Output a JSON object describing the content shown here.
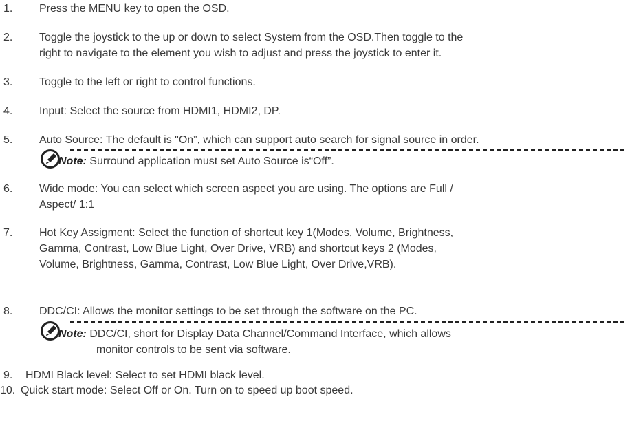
{
  "items": [
    {
      "num": "1.",
      "lines": [
        "Press the MENU key to open the OSD."
      ]
    },
    {
      "num": "2.",
      "lines": [
        "Toggle the joystick to the up or down to select System from the OSD.Then toggle to the",
        "right to navigate to the element you wish to adjust and press the joystick to enter it."
      ]
    },
    {
      "num": "3.",
      "lines": [
        "Toggle to the left or right to control functions."
      ]
    },
    {
      "num": "4.",
      "lines": [
        "Input: Select the source from HDMI1, HDMI2, DP."
      ]
    },
    {
      "num": "5.",
      "lines": [
        "Auto Source: The default is \"On”, which can support auto search for signal source in order."
      ]
    },
    {
      "num": "6.",
      "lines": [
        "Wide mode: You can select which screen aspect you are using. The options are Full /",
        " Aspect/ 1:1"
      ]
    },
    {
      "num": "7.",
      "lines": [
        "Hot Key Assigment: Select the function of shortcut key 1(Modes, Volume, Brightness,",
        "Gamma, Contrast, Low Blue Light,  Over Drive, VRB) and shortcut keys 2 (Modes,",
        "Volume, Brightness, Gamma, Contrast, Low Blue Light,  Over Drive,VRB)."
      ]
    },
    {
      "num": "8.",
      "lines": [
        "DDC/CI: Allows the monitor settings to be set through the software on the PC."
      ]
    },
    {
      "num": "9.",
      "lines": [
        "HDMI Black level: Select to set HDMI black level."
      ]
    },
    {
      "num": "10.",
      "lines": [
        "Quick start mode: Select Off or On. Turn on to speed up boot speed."
      ]
    }
  ],
  "notes": [
    {
      "label": "Note:",
      "lines": [
        "Surround application must set Auto Source is“Off”."
      ]
    },
    {
      "label": "Note:",
      "lines": [
        "DDC/CI, short for Display Data Channel/Command Interface, which allows",
        "monitor controls to be sent via software."
      ]
    }
  ],
  "icons": {
    "note": "note-pencil-icon"
  }
}
